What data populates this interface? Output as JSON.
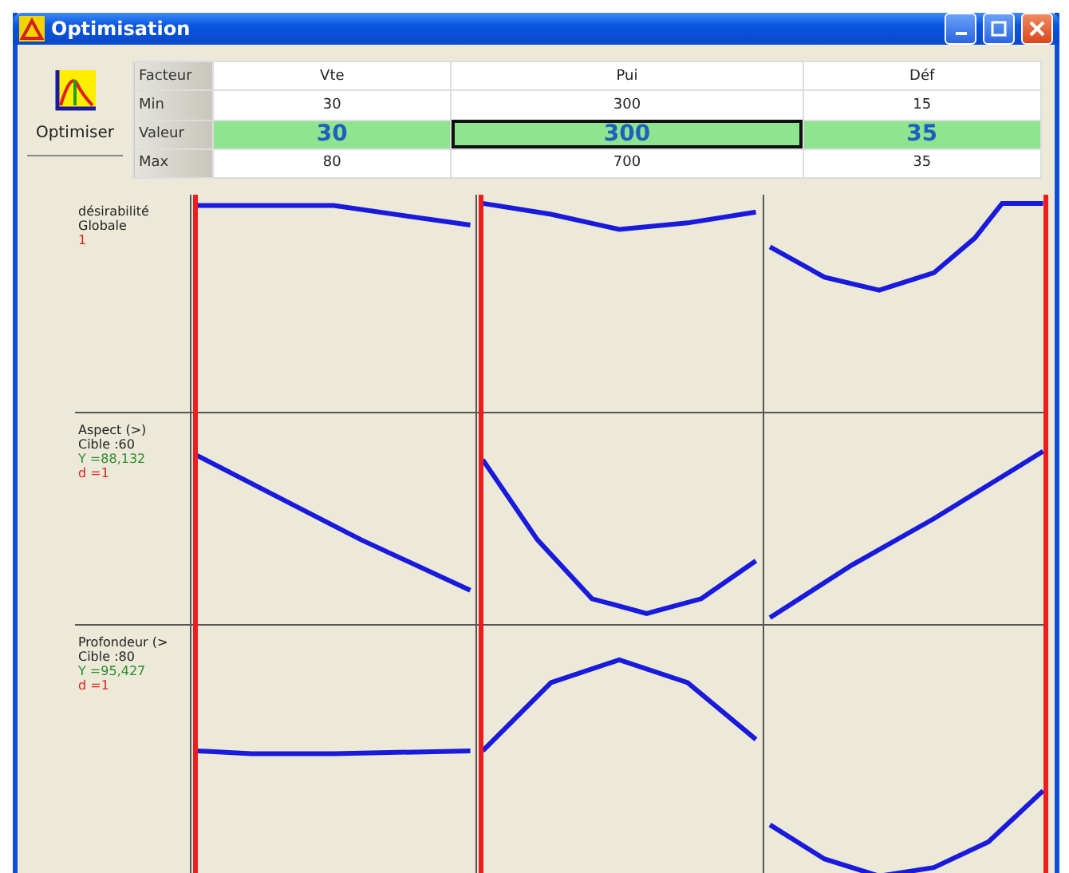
{
  "window": {
    "title": "Optimisation"
  },
  "optimize_button": {
    "label": "Optimiser"
  },
  "table": {
    "rows": [
      {
        "kind": "header",
        "label": "Facteur",
        "cells": [
          {
            "text": "Vte",
            "selected": false
          },
          {
            "text": "Pui",
            "selected": false
          },
          {
            "text": "Déf",
            "selected": false
          }
        ]
      },
      {
        "kind": "plain",
        "label": "Min",
        "cells": [
          {
            "text": "30",
            "selected": false
          },
          {
            "text": "300",
            "selected": false
          },
          {
            "text": "15",
            "selected": false
          }
        ]
      },
      {
        "kind": "value",
        "label": "Valeur",
        "cells": [
          {
            "text": "30",
            "selected": false
          },
          {
            "text": "300",
            "selected": true
          },
          {
            "text": "35",
            "selected": false
          }
        ]
      },
      {
        "kind": "plain",
        "label": "Max",
        "cells": [
          {
            "text": "80",
            "selected": false
          },
          {
            "text": "700",
            "selected": false
          },
          {
            "text": "35",
            "selected": false
          }
        ]
      }
    ]
  },
  "plots": {
    "markers": [
      {
        "level": 0
      },
      {
        "level": 0
      },
      {
        "level": 1
      }
    ],
    "responses": [
      {
        "lines": [
          {
            "kind": "name",
            "text": "désirabilité"
          },
          {
            "kind": "name",
            "text": "Globale"
          },
          {
            "kind": "desirability",
            "text": "1"
          }
        ]
      },
      {
        "lines": [
          {
            "kind": "name",
            "text": "Aspect (>)"
          },
          {
            "kind": "name",
            "text": "Cible :60"
          },
          {
            "kind": "value",
            "text": "Y =88,132"
          },
          {
            "kind": "desirability",
            "text": "d =1"
          }
        ]
      },
      {
        "lines": [
          {
            "kind": "name",
            "text": "Profondeur (>"
          },
          {
            "kind": "name",
            "text": "Cible :80"
          },
          {
            "kind": "value",
            "text": "Y =95,427"
          },
          {
            "kind": "desirability",
            "text": "d =1"
          }
        ]
      }
    ]
  }
}
